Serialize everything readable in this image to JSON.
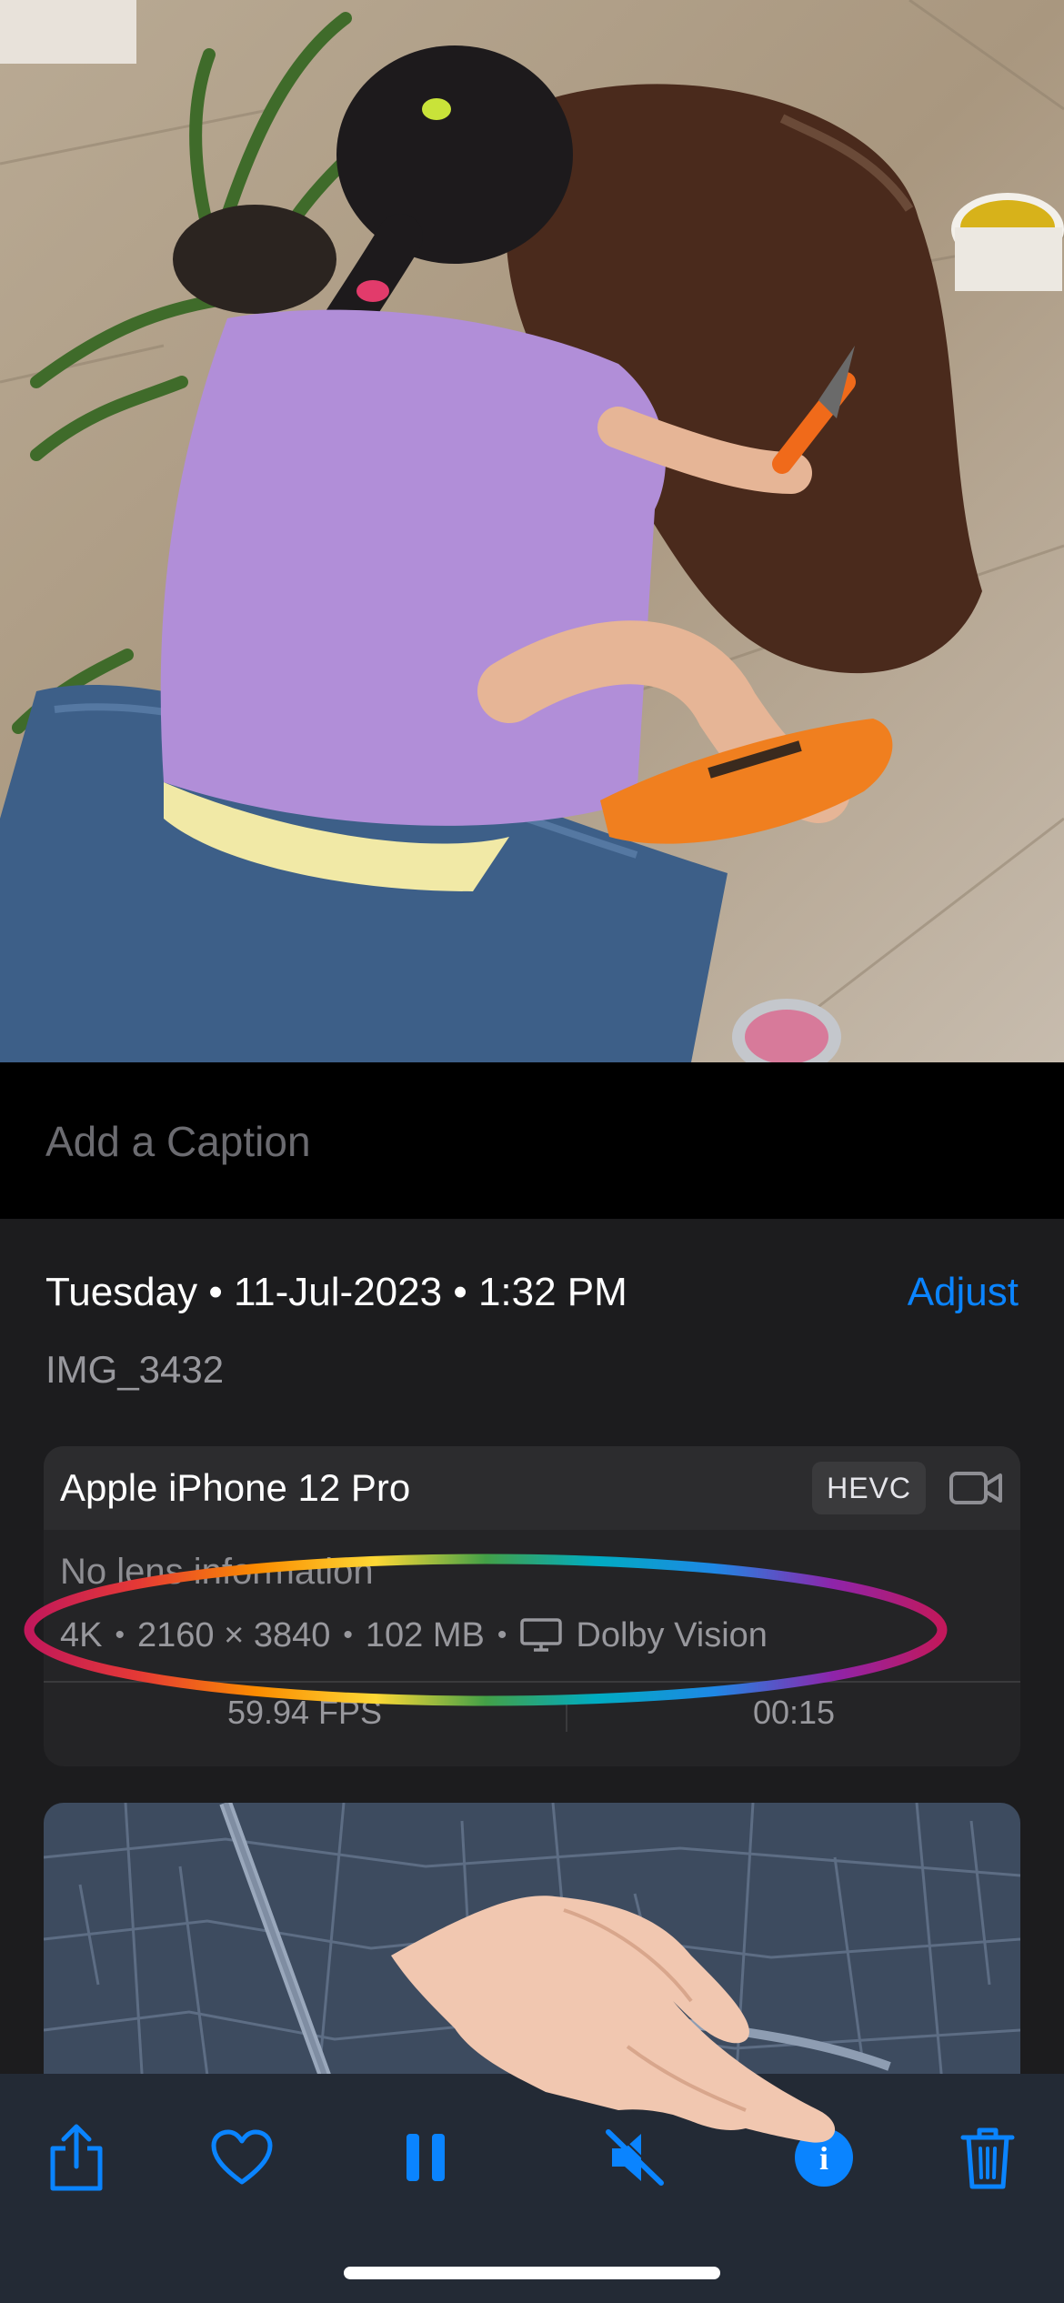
{
  "caption": {
    "placeholder": "Add a Caption"
  },
  "info": {
    "date_line": "Tuesday • 11-Jul-2023 • 1:32 PM",
    "adjust_label": "Adjust",
    "filename": "IMG_3432"
  },
  "metadata_card": {
    "device": "Apple iPhone 12 Pro",
    "codec_badge": "HEVC",
    "lens": "No lens information",
    "resolution_label": "4K",
    "dimensions": "2160 × 3840",
    "file_size": "102 MB",
    "hdr_format": "Dolby Vision",
    "frame_rate": "59.94 FPS",
    "duration": "00:15",
    "separator": "•"
  },
  "toolbar": {
    "icons": [
      "share-icon",
      "heart-icon",
      "pause-icon",
      "mute-icon",
      "info-icon",
      "trash-icon"
    ],
    "info_badge": "i"
  },
  "colors": {
    "accent": "#0a84ff",
    "panel": "#1c1c1e",
    "card": "#242426",
    "toolbar": "#232a35",
    "map": "#3d4b5f"
  }
}
